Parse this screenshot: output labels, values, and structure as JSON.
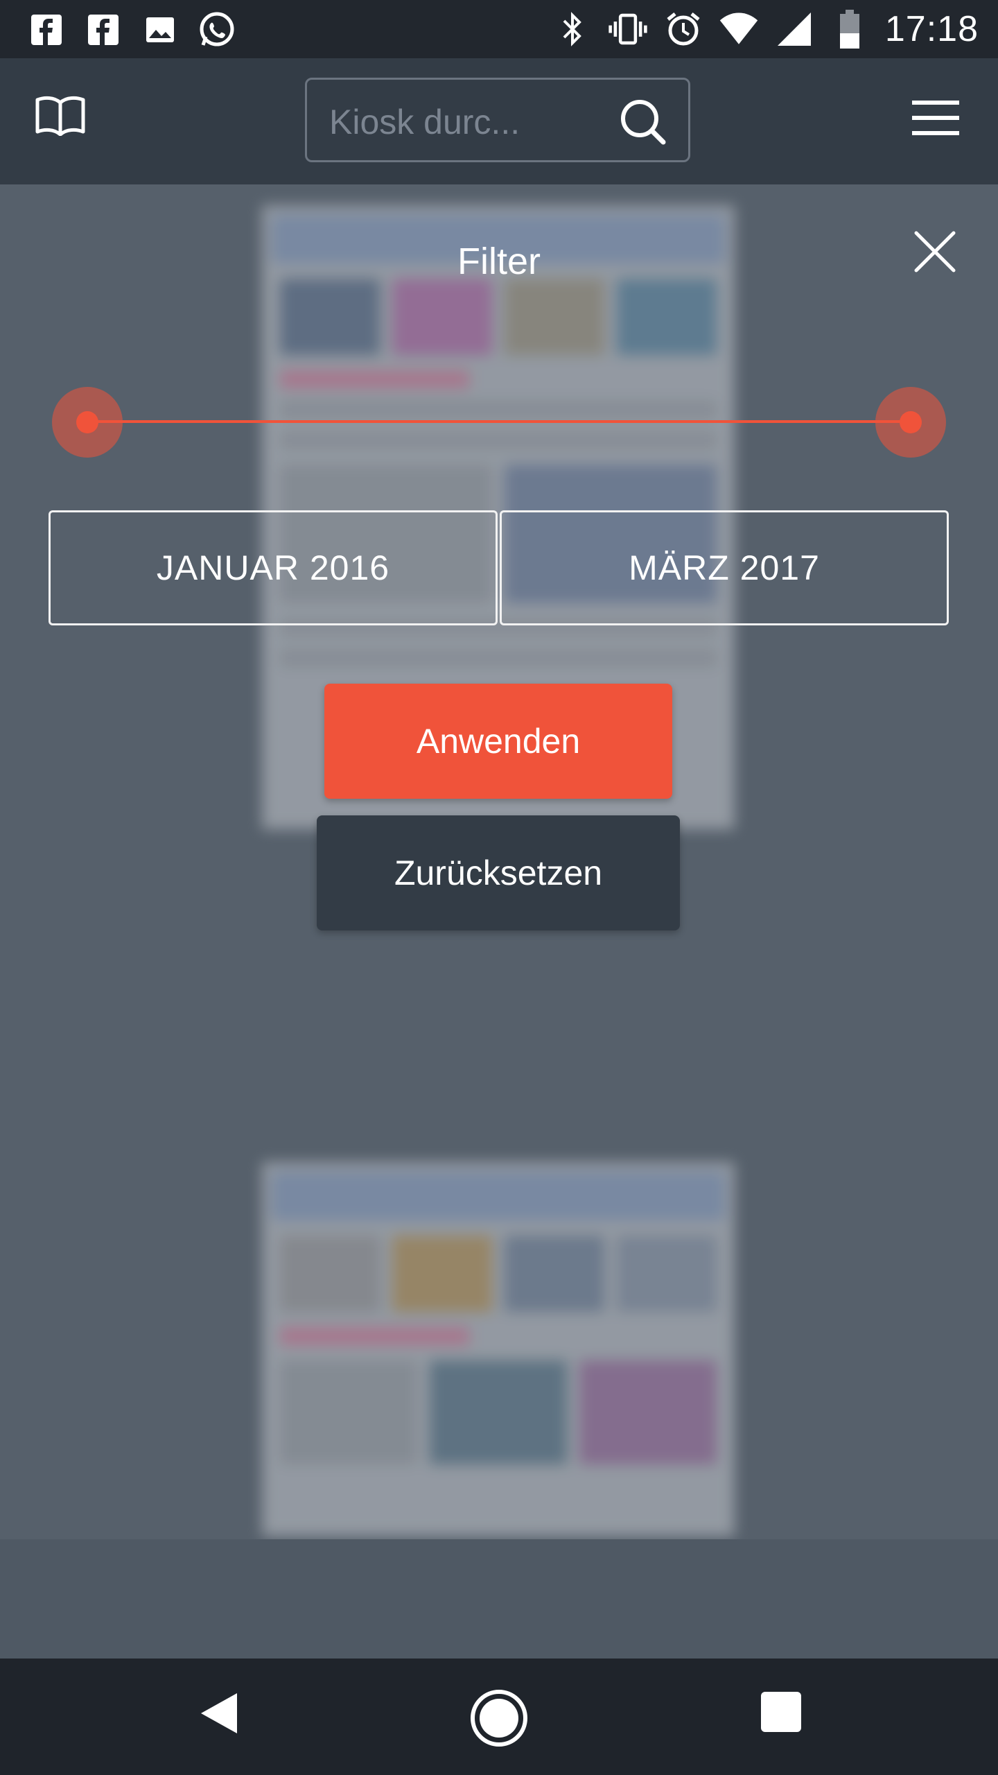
{
  "status_bar": {
    "time": "17:18",
    "left_icons": [
      "facebook-icon",
      "facebook-icon",
      "gallery-icon",
      "whatsapp-icon"
    ],
    "right_icons": [
      "bluetooth-icon",
      "vibrate-icon",
      "alarm-icon",
      "wifi-icon",
      "signal-icon",
      "battery-icon"
    ]
  },
  "header": {
    "search": {
      "placeholder": "Kiosk durc...",
      "value": ""
    },
    "icons": [
      "book-icon",
      "search-icon",
      "menu-icon"
    ]
  },
  "filter": {
    "title": "Filter",
    "range": {
      "from": "JANUAR 2016",
      "to": "MÄRZ 2017",
      "from_position": 0,
      "to_position": 1
    },
    "apply_label": "Anwenden",
    "reset_label": "Zurücksetzen"
  },
  "colors": {
    "accent": "#f0533a",
    "header_bg": "#333c46",
    "status_bg": "#22272e",
    "overlay_bg": "#56606b"
  },
  "nav_bar": {
    "icons": [
      "back-icon",
      "home-icon",
      "recent-apps-icon"
    ]
  }
}
